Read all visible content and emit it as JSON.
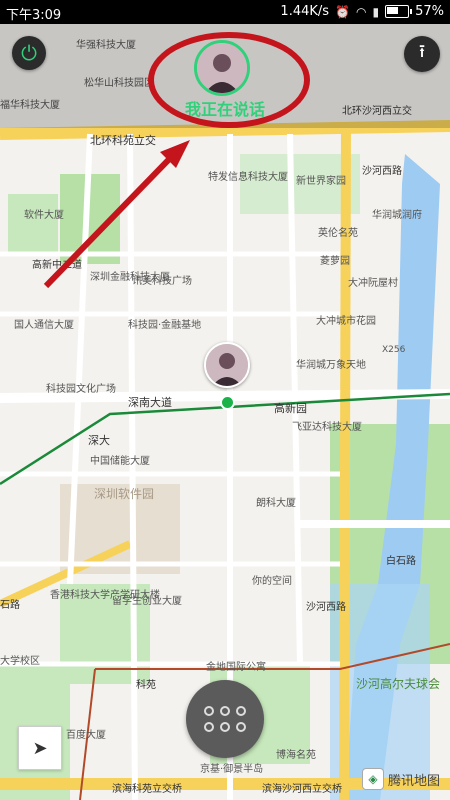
{
  "status_bar": {
    "time": "下午3:09",
    "network_speed": "1.44K/s",
    "battery": "57%"
  },
  "controls": {
    "power_icon": "power-icon",
    "upload_icon": "upload-to-top-icon",
    "speaking_label": "我正在说话",
    "locate_icon": "locate-arrow-icon",
    "menu_icon": "grid-menu-icon"
  },
  "map": {
    "brand": "腾讯地图",
    "labels": {
      "huaqiang": "华强科技大厦",
      "songhua": "松华山科技园区",
      "fuhua": "福华科技大厦",
      "kejibei": "北环科苑立交",
      "beihuan_he": "北环沙河西立交",
      "tefa": "特发信息科技大厦",
      "xinshijie": "新世界家园",
      "shahexi_road": "沙河西路",
      "ruanjian": "软件大厦",
      "huachengyuan": "华润城润府",
      "yingguang": "英伦名苑",
      "gaoxinzhong": "高新中二道",
      "jinrong": "深圳金融科技大厦",
      "xunmei": "讯美科技广场",
      "lingyun": "菱萝园",
      "dacheng": "大冲阮屋村",
      "guoren": "国人通信大厦",
      "kejiyuan_jd": "科技园·金融基地",
      "dachong_ct": "大冲城市花园",
      "huarun_mall": "华润城万象天地",
      "x256": "X256",
      "kejiyuan_wh": "科技园文化广场",
      "shennan": "深南大道",
      "gaoxinyuan": "高新园",
      "feiyada": "飞亚达科技大厦",
      "shenda": "深大",
      "zhongguo_chuneng": "中国储能大厦",
      "ruanjianyuan": "深圳软件园",
      "langke": "朗科大厦",
      "baishi_road": "白石路",
      "nide_kongjian": "你的空间",
      "xianggang": "香港科技大学产学研大楼",
      "liuxuesheng": "留学生创业大厦",
      "shahexi2": "沙河西路",
      "shida": "石路",
      "shenda_xiaoqu": "大学校区",
      "jindi_gongyu": "金地国际公寓",
      "kejiyuan_metro": "科苑",
      "shaheer": "沙河高尔夫球会",
      "binhai_keyuan": "滨海科苑立交桥",
      "binhai_shahe": "滨海沙河西立交桥",
      "boyi": "博海名苑",
      "jingdi": "京基·御景半岛",
      "yiqu": "百度大厦"
    }
  },
  "colors": {
    "accent_green": "#31d07a",
    "annotation_red": "#c4151c",
    "road_yellow": "#f7d25a",
    "water_blue": "#9ecbf2",
    "park_green": "#b7e0a7"
  }
}
